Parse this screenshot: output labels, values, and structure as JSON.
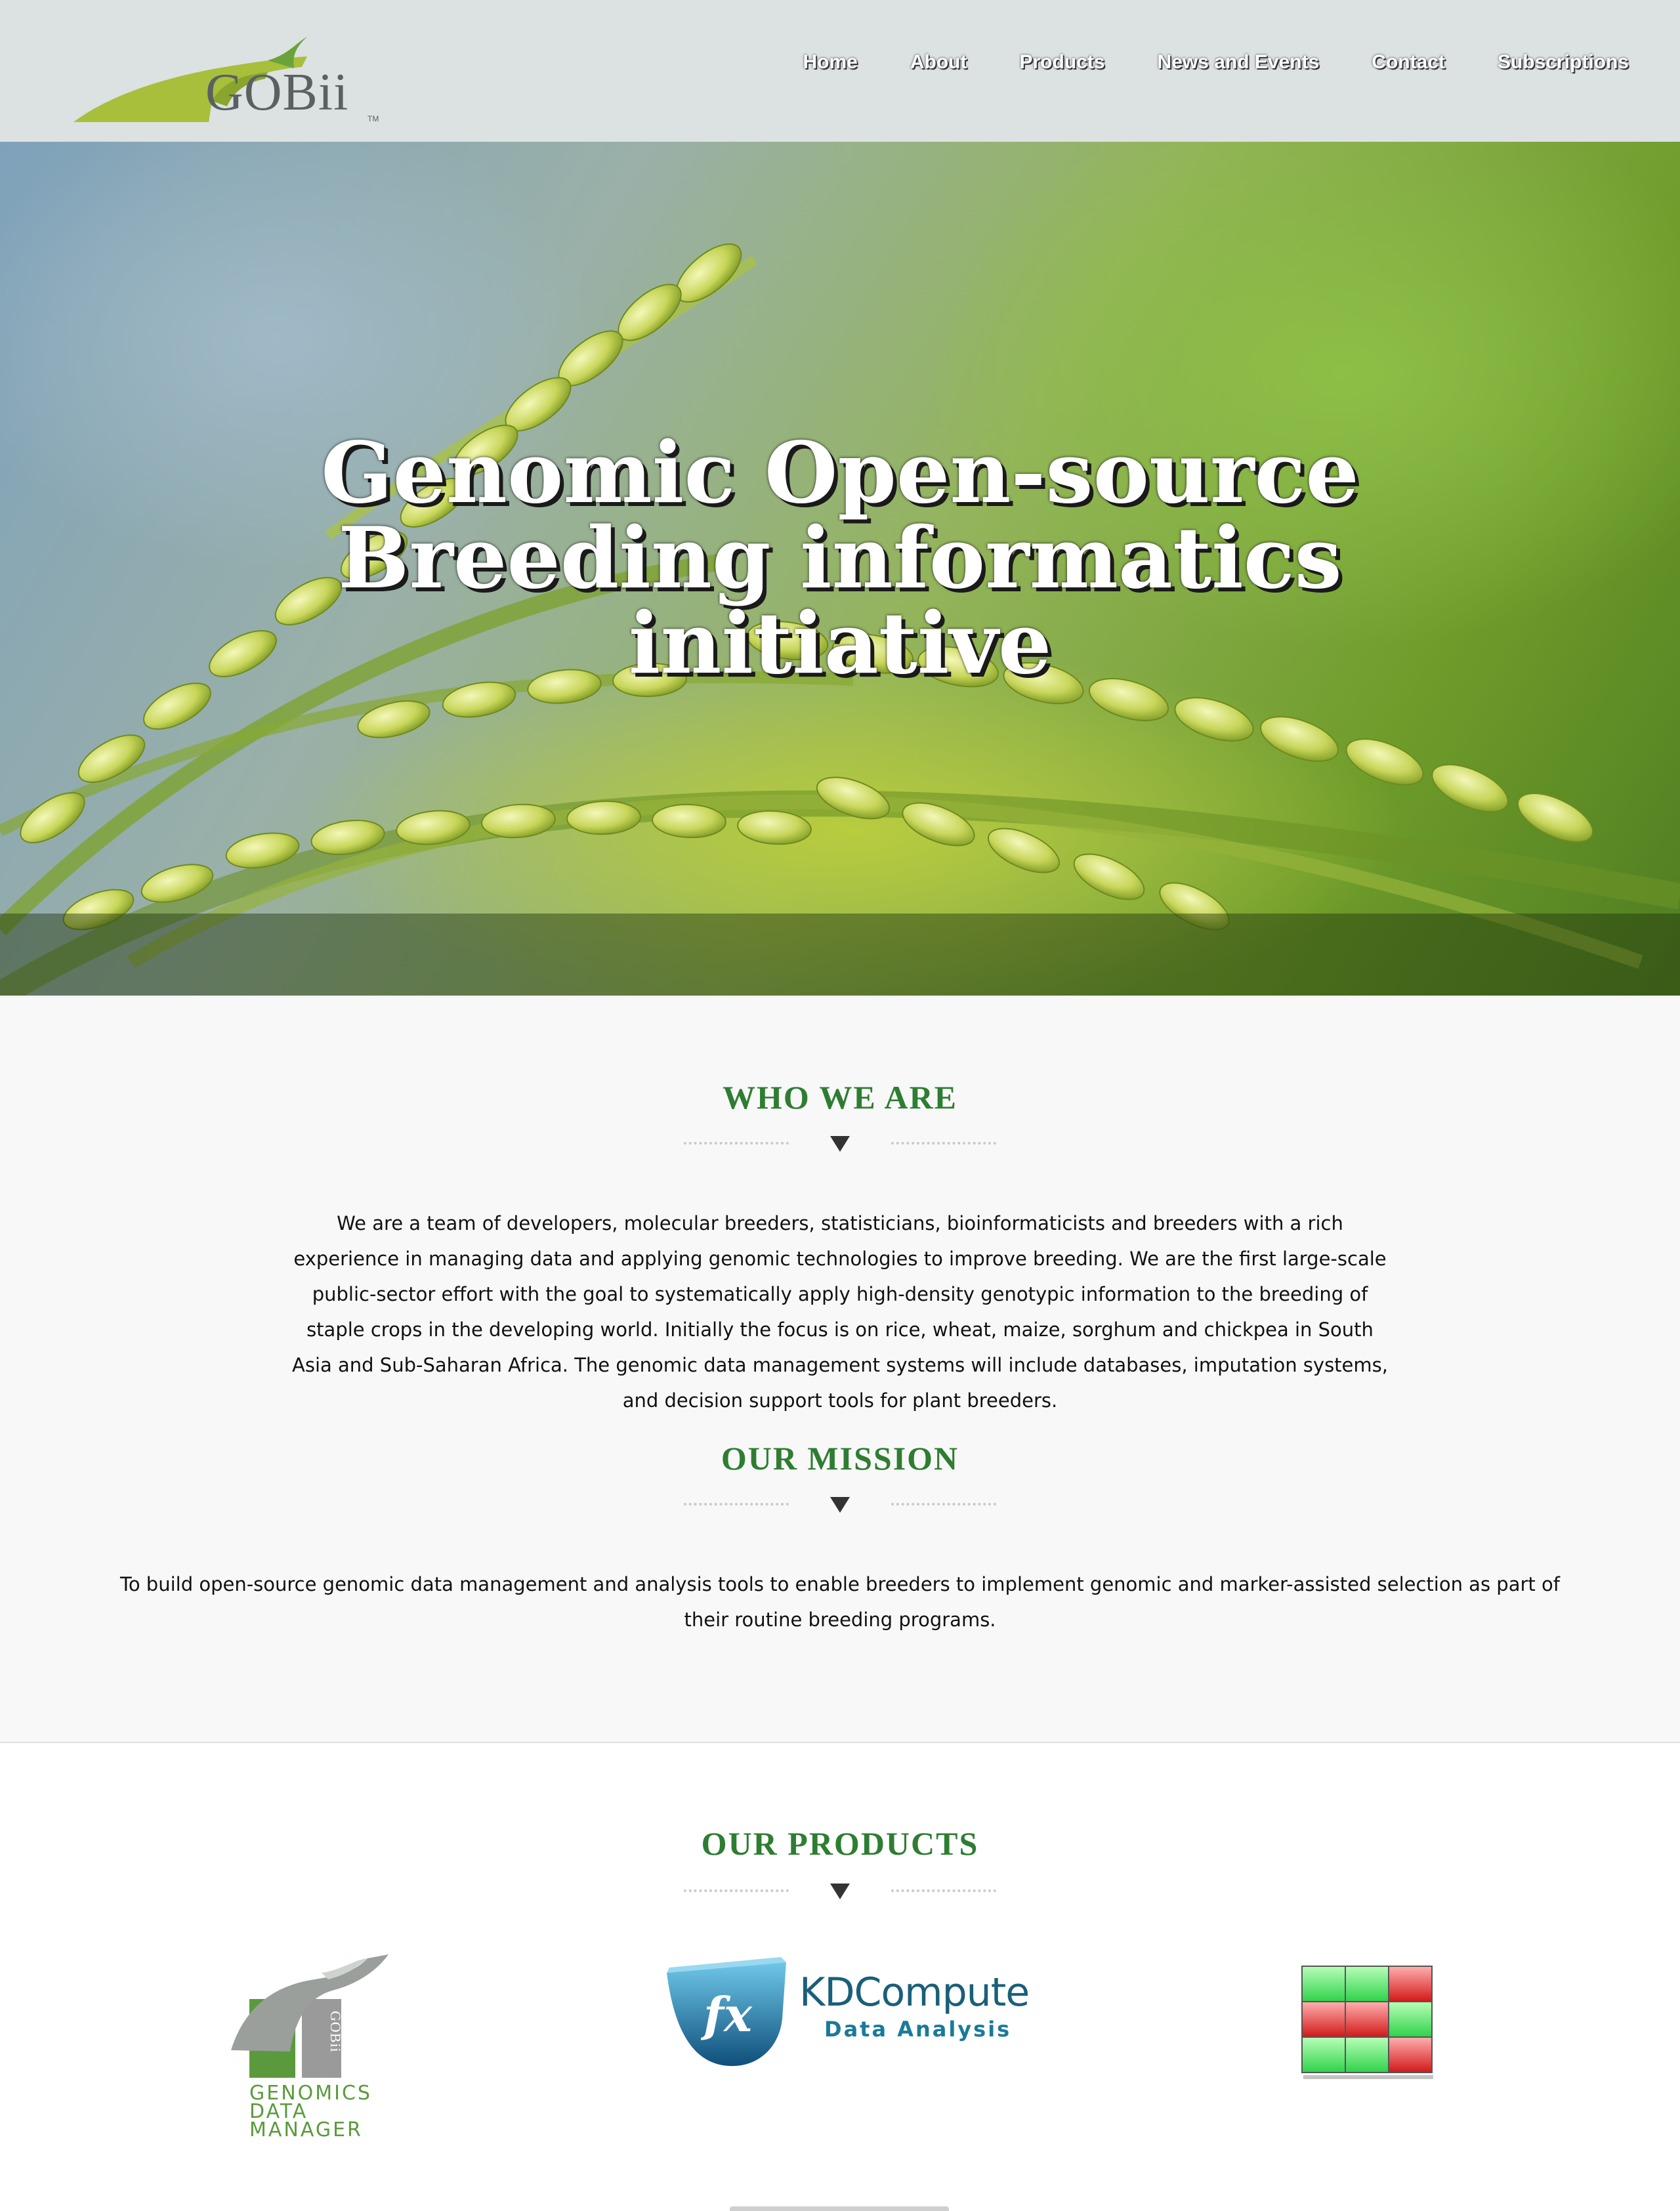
{
  "header": {
    "logo_text": "GOBii",
    "logo_tm": "TM",
    "nav": [
      "Home",
      "About",
      "Products",
      "News and Events",
      "Contact",
      "Subscriptions"
    ]
  },
  "hero": {
    "title": "Genomic Open-source Breeding informatics initiative"
  },
  "who_we_are": {
    "heading": "WHO WE ARE",
    "text": "We are a team of developers, molecular breeders, statisticians, bioinformaticists and breeders with a rich experience in managing data and applying genomic technologies to improve breeding. We are the first large-scale public-sector effort with the goal to systematically apply high-density genotypic information to the breeding of staple crops in the developing world. Initially the focus is on rice, wheat, maize, sorghum and chickpea in South Asia and Sub-Saharan Africa. The genomic data management systems will include databases, imputation systems, and decision support tools for plant breeders."
  },
  "mission": {
    "heading": "OUR MISSION",
    "text": "To build open-source genomic data management and analysis tools to enable breeders to implement genomic and marker-assisted selection as part of their routine breeding programs."
  },
  "products": {
    "heading": "OUR PRODUCTS",
    "gdm": {
      "badge": "GOBii",
      "line1": "GENOMICS",
      "line2": "DATA",
      "line3": "MANAGER"
    },
    "kdcompute": {
      "title": "KDCompute",
      "subtitle": "Data Analysis",
      "icon_text": "fx"
    },
    "third": {
      "icon": "heatmap-grid-icon"
    }
  },
  "colors": {
    "header_bg": "#dce1e1",
    "heading_green": "#2e7d32",
    "section_bg": "#f8f8f8",
    "logo_green": "#a7bf3a"
  }
}
